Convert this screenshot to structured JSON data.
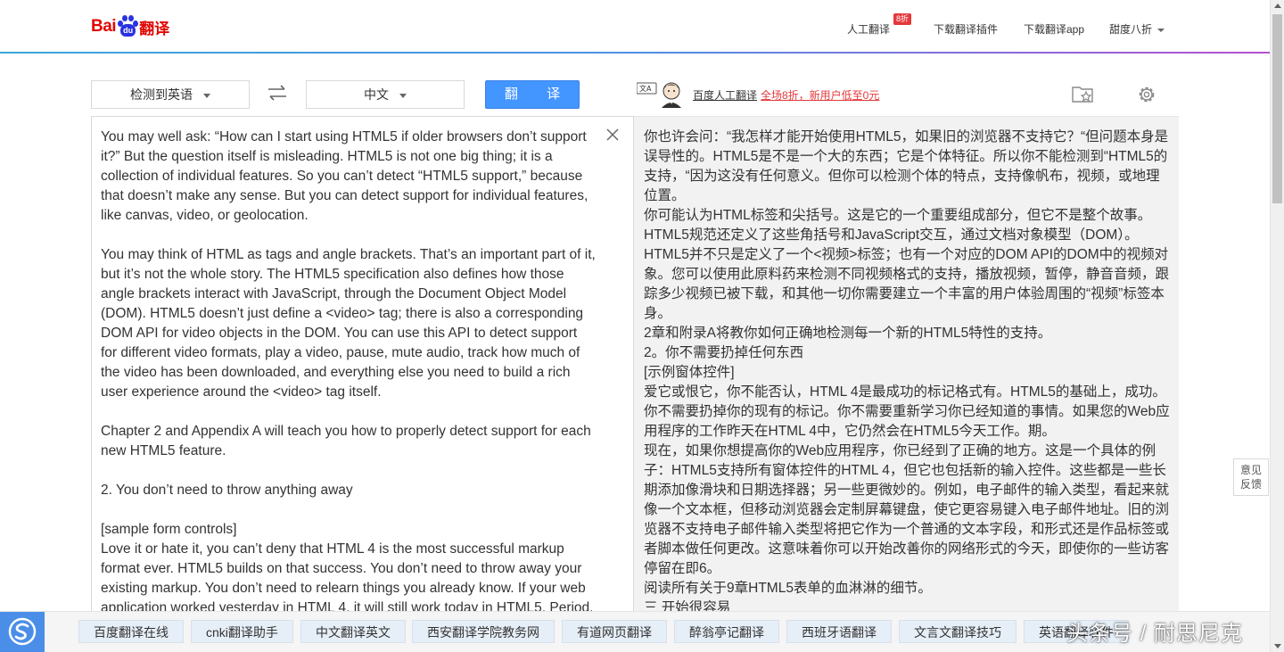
{
  "header": {
    "logo": {
      "bai": "Bai",
      "du": "du",
      "product": "翻译"
    },
    "nav": {
      "human_translate": "人工翻译",
      "human_badge": "8折",
      "download_plugin": "下载翻译插件",
      "download_app": "下载翻译app",
      "discount": "甜度八折"
    }
  },
  "toolbar": {
    "source_lang": "检测到英语",
    "target_lang": "中文",
    "translate_button": "翻 译",
    "human_link": "百度人工翻译",
    "human_promo": "全场8折，新用户低至0元"
  },
  "source": {
    "text": "You may well ask: “How can I start using HTML5 if older browsers don’t support it?” But the question itself is misleading. HTML5 is not one big thing; it is a collection of individual features. So you can’t detect “HTML5 support,” because that doesn’t make any sense. But you can detect support for individual features, like canvas, video, or geolocation.\n\nYou may think of HTML as tags and angle brackets. That’s an important part of it, but it’s not the whole story. The HTML5 specification also defines how those angle brackets interact with JavaScript, through the Document Object Model (DOM). HTML5 doesn’t just define a <video> tag; there is also a corresponding DOM API for video objects in the DOM. You can use this API to detect support for different video formats, play a video, pause, mute audio, track how much of the video has been downloaded, and everything else you need to build a rich user experience around the <video> tag itself.\n\nChapter 2 and Appendix A will teach you how to properly detect support for each new HTML5 feature.\n\n2. You don’t need to throw anything away\n\n[sample form controls]\nLove it or hate it, you can’t deny that HTML 4 is the most successful markup format ever. HTML5 builds on that success. You don’t need to throw away your existing markup. You don’t need to relearn things you already know. If your web application worked yesterday in HTML 4, it will still work today in HTML5. Period."
  },
  "target": {
    "text": "你也许会问：“我怎样才能开始使用HTML5，如果旧的浏览器不支持它？“但问题本身是误导性的。HTML5是不是一个大的东西；它是个体特征。所以你不能检测到“HTML5的支持，“因为这没有任何意义。但你可以检测个体的特点，支持像帆布，视频，或地理位置。\n你可能认为HTML标签和尖括号。这是它的一个重要组成部分，但它不是整个故事。HTML5规范还定义了这些角括号和JavaScript交互，通过文档对象模型（DOM）。HTML5并不只是定义了一个<视频>标签；也有一个对应的DOM API的DOM中的视频对象。您可以使用此原料药来检测不同视频格式的支持，播放视频，暂停，静音音频，跟踪多少视频已被下载，和其他一切你需要建立一个丰富的用户体验周围的“视频”标签本身。\n2章和附录A将教你如何正确地检测每一个新的HTML5特性的支持。\n2。你不需要扔掉任何东西\n[示例窗体控件]\n爱它或恨它，你不能否认，HTML 4是最成功的标记格式有。HTML5的基础上，成功。你不需要扔掉你的现有的标记。你不需要重新学习你已经知道的事情。如果您的Web应用程序的工作昨天在HTML 4中，它仍然会在HTML5今天工作。期。\n现在，如果你想提高你的Web应用程序，你已经到了正确的地方。这是一个具体的例子：HTML5支持所有窗体控件的HTML 4，但它也包括新的输入控件。这些都是一些长期添加像滑块和日期选择器；另一些更微妙的。例如，电子邮件的输入类型，看起来就像一个文本框，但移动浏览器会定制屏幕键盘，使它更容易键入电子邮件地址。旧的浏览器不支持电子邮件输入类型将把它作为一个普通的文本字段，和形式还是作品标签或者脚本做任何更改。这意味着你可以开始改善你的网络形式的今天，即使你的一些访客停留在即6。\n阅读所有关于9章HTML5表单的血淋淋的细节。\n三 开始很容易"
  },
  "feedback": {
    "line1": "意见",
    "line2": "反馈"
  },
  "bottom_tags": [
    "百度翻译在线",
    "cnki翻译助手",
    "中文翻译英文",
    "西安翻译学院教务网",
    "有道网页翻译",
    "醉翁亭记翻译",
    "西班牙语翻译",
    "文言文翻译技巧",
    "英语翻译软件"
  ],
  "watermark": "头条号 / 耐思尼克",
  "colors": {
    "accent": "#4395ff",
    "brand_red": "#e10602",
    "brand_blue": "#2932e1",
    "promo_red": "#e4393c"
  }
}
